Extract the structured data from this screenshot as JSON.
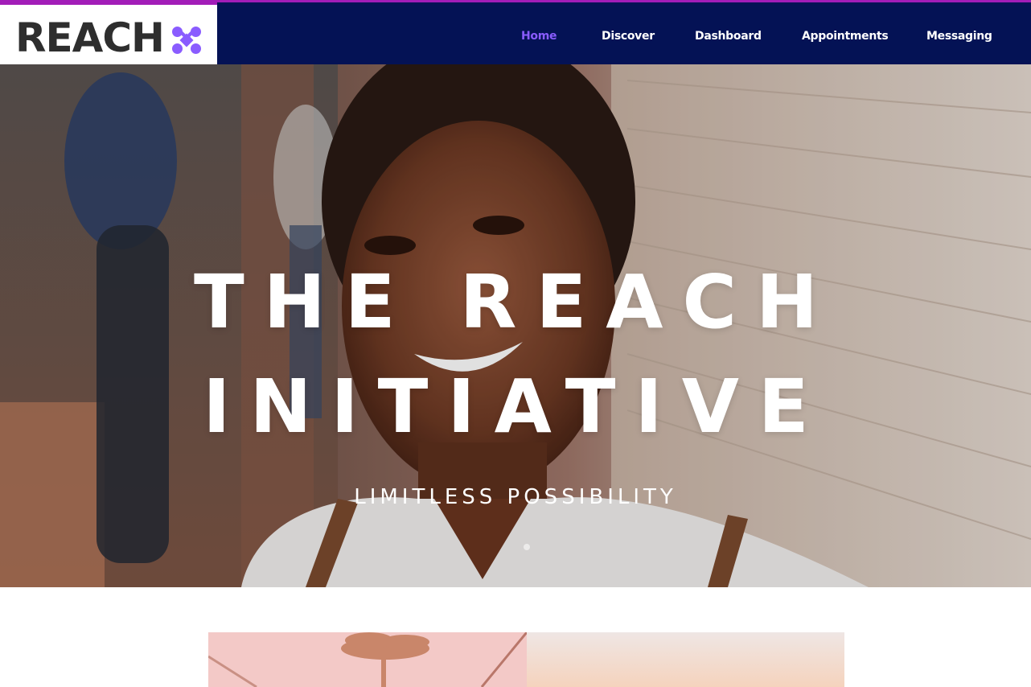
{
  "header": {
    "logo_text": "REACH",
    "logo_icon": "x-mark-icon",
    "nav": [
      {
        "label": "Home",
        "active": true
      },
      {
        "label": "Discover",
        "active": false
      },
      {
        "label": "Dashboard",
        "active": false
      },
      {
        "label": "Appointments",
        "active": false
      },
      {
        "label": "Messaging",
        "active": false
      }
    ]
  },
  "hero": {
    "title_line1": "THE REACH",
    "title_line2": "INITIATIVE",
    "subtitle": "LIMITLESS POSSIBILITY",
    "background_image": "smiling-student-photo"
  },
  "cards": {
    "left_image": "palm-tree-sunset-photo",
    "right_image": "pastel-sky-photo"
  },
  "colors": {
    "nav_background": "#041255",
    "accent_stripe": "#a21db8",
    "active_nav": "#8a5cff",
    "logo_text": "#2e2e2e",
    "logo_icon": "#8a5cff"
  }
}
